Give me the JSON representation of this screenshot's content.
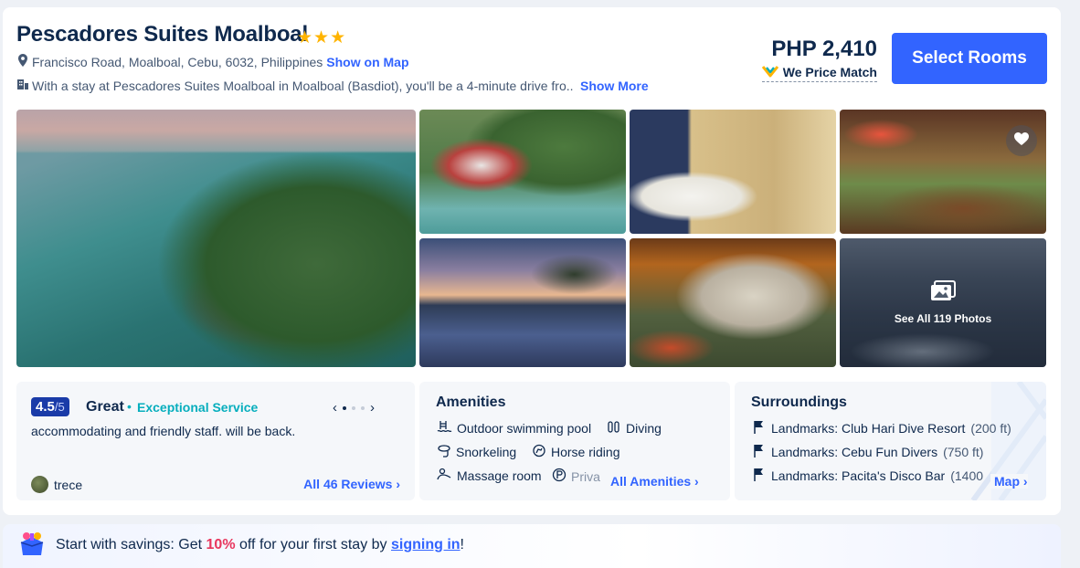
{
  "hotel": {
    "name": "Pescadores Suites Moalboal",
    "stars": "★★★",
    "address": "Francisco Road, Moalboal, Cebu, 6032, Philippines",
    "show_on_map": "Show on Map",
    "description": "With a stay at Pescadores Suites Moalboal in Moalboal (Basdiot), you'll be a 4-minute drive fro...",
    "show_more": "Show More"
  },
  "pricing": {
    "price": "PHP 2,410",
    "price_match": "We Price Match",
    "select_rooms": "Select Rooms"
  },
  "gallery": {
    "see_all": "See All 119 Photos",
    "photos": [
      "aerial-coast",
      "resort-aerial",
      "bedroom",
      "restaurant",
      "infinity-pool",
      "building-night",
      "boats-bay"
    ]
  },
  "review": {
    "score": "4.5",
    "score_max": "/5",
    "rating_word": "Great",
    "dot": "•",
    "highlight": "Exceptional Service",
    "prev": "‹",
    "next": "›",
    "quote": "accommodating and friendly staff. will be back.",
    "reviewer": "trece",
    "all_reviews": "All 46 Reviews ›"
  },
  "amenities": {
    "title": "Amenities",
    "items": [
      "Outdoor swimming pool",
      "Diving",
      "Snorkeling",
      "Horse riding",
      "Massage room",
      "Priva"
    ],
    "all_link": "All Amenities ›"
  },
  "surroundings": {
    "title": "Surroundings",
    "items": [
      {
        "label": "Landmarks: Club Hari Dive Resort",
        "dist": "(200 ft)"
      },
      {
        "label": "Landmarks: Cebu Fun Divers",
        "dist": "(750 ft)"
      },
      {
        "label": "Landmarks: Pacita's Disco Bar",
        "dist": "(1400"
      }
    ],
    "map_link": "Map ›"
  },
  "promo": {
    "prefix": "Start with savings: Get ",
    "percent": "10%",
    "middle": " off for your first stay by ",
    "signin": "signing in",
    "suffix": "!"
  },
  "colors": {
    "accent": "#3264ff",
    "star": "#ffb400",
    "score_bg": "#1a3ba8",
    "highlight": "#06aebd",
    "promo_pct": "#e8365d"
  }
}
